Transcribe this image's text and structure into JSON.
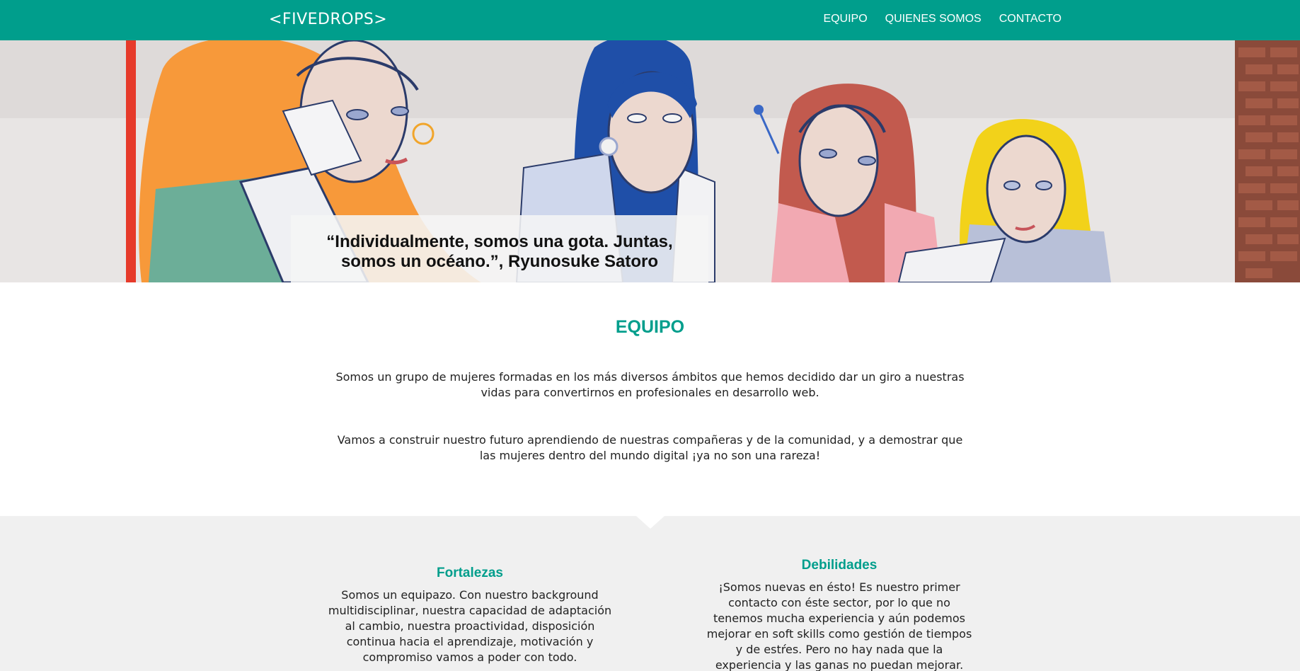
{
  "nav": {
    "logo": "<FIVEDROPS>",
    "links": [
      "EQUIPO",
      "QUIENES SOMOS",
      "CONTACTO"
    ]
  },
  "hero": {
    "quote": "“Individualmente, somos una gota. Juntas, somos un océano.”, Ryunosuke Satoro"
  },
  "equipo": {
    "title": "EQUIPO",
    "paragraphs": [
      "Somos un grupo de mujeres formadas en los más diversos ámbitos que hemos decidido dar un giro a nuestras vidas para convertirnos en profesionales en desarrollo web.",
      "Vamos a construir nuestro futuro aprendiendo de nuestras compañeras y de la comunidad, y a demostrar que las mujeres dentro del mundo digital ¡ya no son una rareza!"
    ]
  },
  "swot": {
    "fortalezas": {
      "title": "Fortalezas",
      "text": "Somos un equipazo. Con nuestro background multidisciplinar, nuestra capacidad de adaptación al cambio, nuestra proactividad, disposición continua hacia el aprendizaje, motivación y compromiso vamos a poder con todo."
    },
    "debilidades": {
      "title": "Debilidades",
      "text": "¡Somos nuevas en ésto! Es nuestro primer contacto con éste sector, por lo que no tenemos mucha experiencia y aún podemos mejorar en soft skills como gestión de tiempos y de estŕes. Pero no hay nada que la experiencia y las ganas no puedan mejorar."
    }
  },
  "colors": {
    "brand": "#009e8c",
    "light_bg": "#f0f0f0"
  }
}
